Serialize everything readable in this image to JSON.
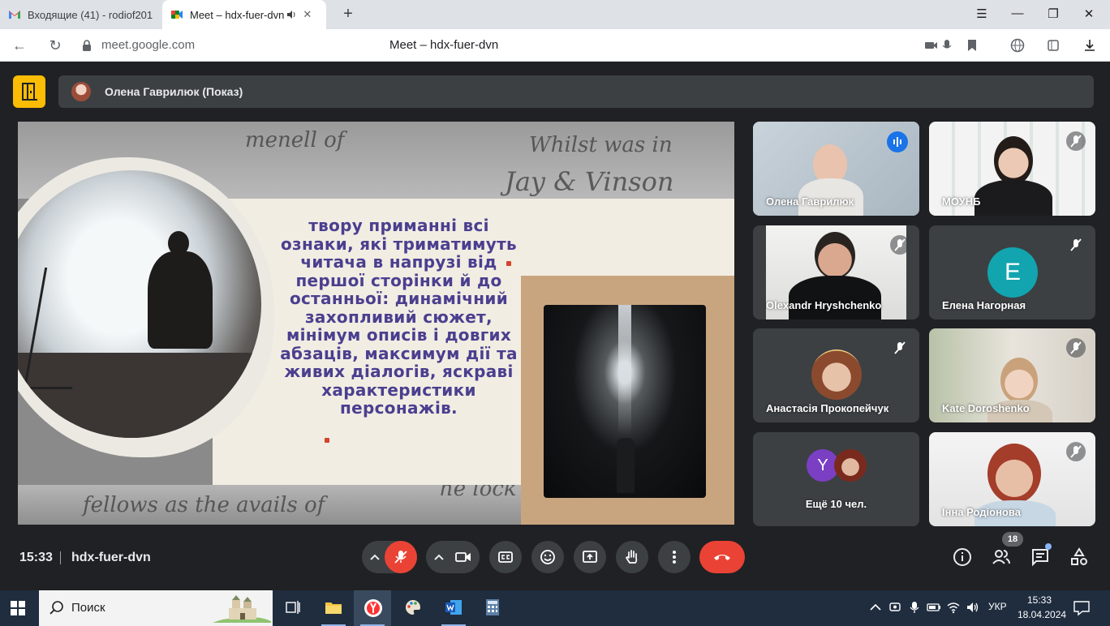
{
  "browser": {
    "tabs": [
      {
        "title": "Входящие (41) - rodiof201",
        "favicon": "gmail-icon"
      },
      {
        "title": "Meet – hdx-fuer-dvn",
        "favicon": "meet-icon",
        "audio": true
      }
    ],
    "new_tab": "+",
    "window_controls": {
      "menu": "☰",
      "minimize": "—",
      "restore": "❐",
      "close": "✕"
    },
    "url": "meet.google.com",
    "page_title": "Meet – hdx-fuer-dvn"
  },
  "meet": {
    "presenter_label": "Олена Гаврилюк (Показ)",
    "slide_text": "твору приманні всі ознаки, які триматимуть читача в напрузі від першої сторінки й до останньої: динамічний захопливий сюжет, мінімум описів і довгих абзаців, максимум дії та живих діалогів, яскраві характеристики персонажів.",
    "slide_script": [
      "menell of",
      "Whilst was in",
      "Jay & Vinson",
      "fellows as the avails of",
      "he lock"
    ],
    "participants": [
      {
        "name": "Олена Гаврилюк",
        "status": "speaking"
      },
      {
        "name": "МОУНБ",
        "status": "muted"
      },
      {
        "name": "Olexandr Hryshchenko",
        "status": "muted"
      },
      {
        "name": "Елена Нагорная",
        "status": "muted",
        "avatar_letter": "E"
      },
      {
        "name": "Анастасія Прокопейчук",
        "status": "muted"
      },
      {
        "name": "Kate Doroshenko",
        "status": "muted"
      },
      {
        "name": "Ещё 10 чел.",
        "avatar_letter": "Y"
      },
      {
        "name": "Інна Родіонова",
        "status": "muted"
      }
    ],
    "time": "15:33",
    "meeting_code": "hdx-fuer-dvn",
    "people_count": "18",
    "accent_color": "#1a73e8",
    "end_call_color": "#ea4335"
  },
  "taskbar": {
    "search_placeholder": "Поиск",
    "language": "УКР",
    "clock_time": "15:33",
    "clock_date": "18.04.2024"
  }
}
